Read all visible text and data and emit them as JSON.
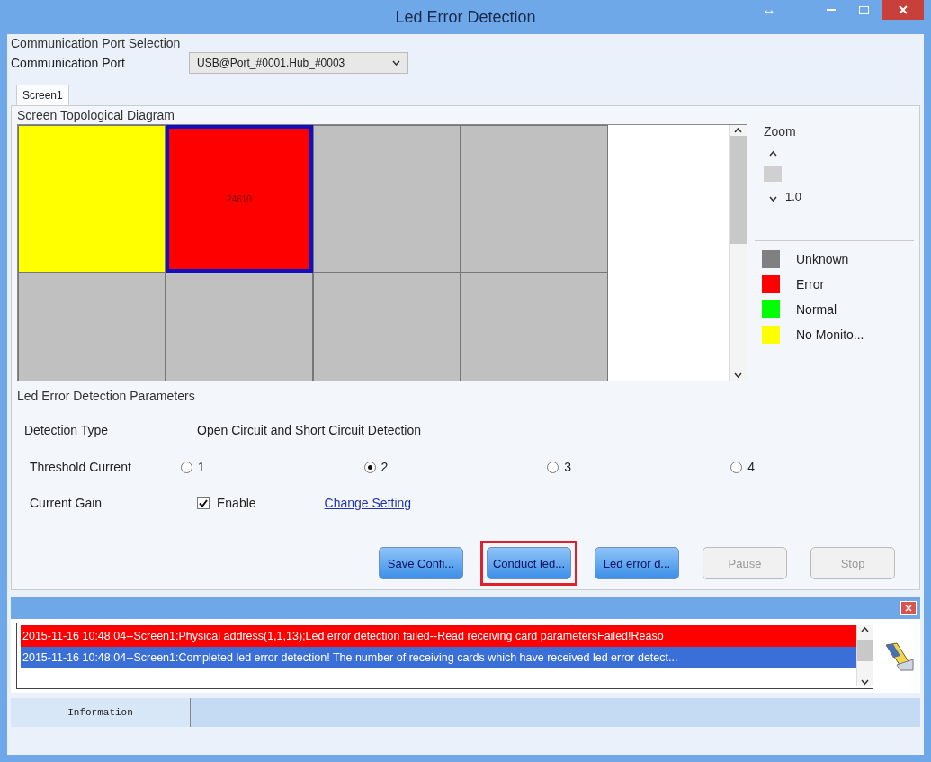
{
  "window": {
    "title": "Led Error Detection",
    "resize_glyph": "↔"
  },
  "port_section": {
    "title": "Communication Port Selection",
    "label": "Communication Port",
    "value": "USB@Port_#0001.Hub_#0003"
  },
  "tabs": [
    {
      "label": "Screen1",
      "selected": true
    }
  ],
  "diagram": {
    "title": "Screen Topological Diagram",
    "cells": [
      {
        "color": "#ffff00",
        "selected": false
      },
      {
        "color": "#ff0000",
        "selected": true,
        "label": "24610"
      },
      {
        "color": "#c0c0c0",
        "selected": false
      },
      {
        "color": "#c0c0c0",
        "selected": false
      },
      {
        "color": "#c0c0c0",
        "selected": false
      },
      {
        "color": "#c0c0c0",
        "selected": false
      },
      {
        "color": "#c0c0c0",
        "selected": false
      },
      {
        "color": "#c0c0c0",
        "selected": false
      }
    ]
  },
  "zoom": {
    "title": "Zoom",
    "value": "1.0"
  },
  "legend": [
    {
      "label": "Unknown",
      "color": "#808080"
    },
    {
      "label": "Error",
      "color": "#ff0000"
    },
    {
      "label": "Normal",
      "color": "#00ff00"
    },
    {
      "label": "No Monito...",
      "color": "#ffff00"
    }
  ],
  "parameters": {
    "title": "Led Error Detection Parameters",
    "detection_type_label": "Detection Type",
    "detection_type": "Open Circuit and Short Circuit Detection",
    "threshold_label": "Threshold Current",
    "thresholds": [
      {
        "label": "1",
        "selected": false
      },
      {
        "label": "2",
        "selected": true
      },
      {
        "label": "3",
        "selected": false
      },
      {
        "label": "4",
        "selected": false
      }
    ],
    "gain_label": "Current Gain",
    "gain": {
      "label": "Enable",
      "checked": true
    },
    "change_link": "Change Setting"
  },
  "buttons": [
    {
      "label": "Save Confi...",
      "disabled": false,
      "highlighted": false
    },
    {
      "label": "Conduct led...",
      "disabled": false,
      "highlighted": true
    },
    {
      "label": "Led error d...",
      "disabled": false,
      "highlighted": false
    },
    {
      "label": "Pause",
      "disabled": true,
      "highlighted": false
    },
    {
      "label": "Stop",
      "disabled": true,
      "highlighted": false
    }
  ],
  "log": [
    {
      "text": "2015-11-16 10:48:04--Screen1:Physical address(1,1,13);Led error detection failed--Read receiving card parametersFailed!Reaso",
      "color": "#ff0000"
    },
    {
      "text": "2015-11-16 10:48:04--Screen1:Completed led error detection! The number of receiving cards which have received led error detect...",
      "color": "#3b6fd8"
    }
  ],
  "status_bar": {
    "tab": "Information"
  }
}
